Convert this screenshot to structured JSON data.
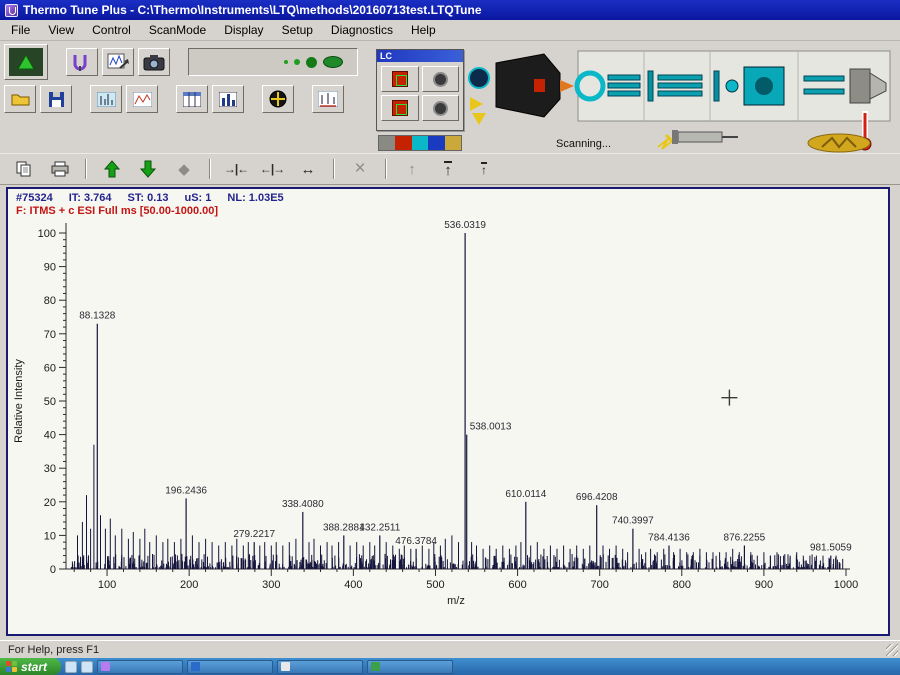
{
  "window": {
    "title": "Thermo Tune Plus - C:\\Thermo\\Instruments\\LTQ\\methods\\20160713test.LTQTune"
  },
  "menu": {
    "items": [
      "File",
      "View",
      "Control",
      "ScanMode",
      "Display",
      "Setup",
      "Diagnostics",
      "Help"
    ]
  },
  "instrument_panel": {
    "lc_title": "LC",
    "scanning_label": "Scanning..."
  },
  "scan_header": {
    "scan_number": "#75324",
    "it": "IT: 3.764",
    "st": "ST: 0.13",
    "us": "uS: 1",
    "nl": "NL: 1.03E5",
    "filter": "F: ITMS + c ESI Full ms [50.00-1000.00]"
  },
  "icons": {
    "compress_x": "→|←",
    "expand_x": "←|→",
    "full_range": "↔",
    "clear": "×",
    "diamond": "◆",
    "arrow_up": "↑"
  },
  "statusbar": {
    "help_text": "For Help, press F1"
  },
  "taskbar": {
    "start_label": "start"
  },
  "colors": {
    "titlebar_blue": "#101fa8",
    "chrome_gray": "#d6d3ce",
    "scan_header_navy": "#23238e",
    "filter_red": "#c41414",
    "spectrum_stick": "#14143c",
    "panel_border_navy": "#1a1a72"
  },
  "chart_data": {
    "type": "mass-spectrum-stick",
    "title": "",
    "xlabel": "m/z",
    "ylabel": "Relative Intensity",
    "xlim": [
      50,
      1000
    ],
    "ylim": [
      0,
      100
    ],
    "x_major_ticks": [
      100,
      200,
      300,
      400,
      500,
      600,
      700,
      800,
      900,
      1000
    ],
    "x_minor_step": 20,
    "y_major_ticks": [
      0,
      10,
      20,
      30,
      40,
      50,
      60,
      70,
      80,
      90,
      100
    ],
    "y_minor_step": 2,
    "grid": false,
    "peaks": [
      {
        "mz": 88.1328,
        "intensity": 73,
        "label": "88.1328"
      },
      {
        "mz": 196.2436,
        "intensity": 21,
        "label": "196.2436"
      },
      {
        "mz": 279.2217,
        "intensity": 8,
        "label": "279.2217"
      },
      {
        "mz": 338.408,
        "intensity": 17,
        "label": "338.4080"
      },
      {
        "mz": 388.2881,
        "intensity": 10,
        "label": "388.2881"
      },
      {
        "mz": 432.2511,
        "intensity": 10,
        "label": "432.2511"
      },
      {
        "mz": 476.3784,
        "intensity": 6,
        "label": "476.3784"
      },
      {
        "mz": 536.0319,
        "intensity": 100,
        "label": "536.0319"
      },
      {
        "mz": 538.0013,
        "intensity": 40,
        "label": "538.0013",
        "label_anchor": "start"
      },
      {
        "mz": 610.0114,
        "intensity": 20,
        "label": "610.0114"
      },
      {
        "mz": 696.4208,
        "intensity": 19,
        "label": "696.4208"
      },
      {
        "mz": 740.3997,
        "intensity": 12,
        "label": "740.3997"
      },
      {
        "mz": 784.4136,
        "intensity": 7,
        "label": "784.4136"
      },
      {
        "mz": 876.2255,
        "intensity": 7,
        "label": "876.2255"
      },
      {
        "mz": 981.5059,
        "intensity": 4,
        "label": "981.5059"
      }
    ],
    "minor_peaks": [
      [
        64,
        10
      ],
      [
        70,
        14
      ],
      [
        75,
        22
      ],
      [
        80,
        12
      ],
      [
        84,
        37
      ],
      [
        92,
        16
      ],
      [
        98,
        12
      ],
      [
        104,
        15
      ],
      [
        110,
        10
      ],
      [
        118,
        12
      ],
      [
        126,
        9
      ],
      [
        132,
        11
      ],
      [
        140,
        9
      ],
      [
        146,
        12
      ],
      [
        152,
        8
      ],
      [
        160,
        10
      ],
      [
        168,
        8
      ],
      [
        174,
        9
      ],
      [
        182,
        8
      ],
      [
        190,
        9
      ],
      [
        204,
        10
      ],
      [
        212,
        8
      ],
      [
        220,
        9
      ],
      [
        228,
        8
      ],
      [
        236,
        7
      ],
      [
        244,
        8
      ],
      [
        252,
        7
      ],
      [
        258,
        9
      ],
      [
        266,
        7
      ],
      [
        272,
        8
      ],
      [
        286,
        7
      ],
      [
        292,
        8
      ],
      [
        300,
        7
      ],
      [
        306,
        8
      ],
      [
        314,
        7
      ],
      [
        322,
        8
      ],
      [
        330,
        9
      ],
      [
        346,
        8
      ],
      [
        352,
        9
      ],
      [
        360,
        7
      ],
      [
        368,
        8
      ],
      [
        374,
        7
      ],
      [
        382,
        8
      ],
      [
        396,
        7
      ],
      [
        404,
        8
      ],
      [
        412,
        7
      ],
      [
        420,
        8
      ],
      [
        426,
        7
      ],
      [
        440,
        8
      ],
      [
        448,
        7
      ],
      [
        456,
        6
      ],
      [
        462,
        7
      ],
      [
        470,
        6
      ],
      [
        484,
        7
      ],
      [
        492,
        6
      ],
      [
        498,
        8
      ],
      [
        506,
        7
      ],
      [
        512,
        9
      ],
      [
        520,
        10
      ],
      [
        528,
        8
      ],
      [
        544,
        8
      ],
      [
        550,
        7
      ],
      [
        558,
        6
      ],
      [
        566,
        7
      ],
      [
        574,
        6
      ],
      [
        582,
        7
      ],
      [
        590,
        6
      ],
      [
        598,
        7
      ],
      [
        604,
        8
      ],
      [
        616,
        7
      ],
      [
        624,
        8
      ],
      [
        632,
        6
      ],
      [
        640,
        7
      ],
      [
        648,
        6
      ],
      [
        656,
        7
      ],
      [
        664,
        6
      ],
      [
        672,
        7
      ],
      [
        680,
        6
      ],
      [
        688,
        7
      ],
      [
        704,
        7
      ],
      [
        712,
        6
      ],
      [
        720,
        7
      ],
      [
        728,
        6
      ],
      [
        734,
        5
      ],
      [
        748,
        6
      ],
      [
        756,
        5
      ],
      [
        762,
        6
      ],
      [
        770,
        5
      ],
      [
        778,
        6
      ],
      [
        790,
        5
      ],
      [
        798,
        6
      ],
      [
        806,
        5
      ],
      [
        814,
        5
      ],
      [
        822,
        6
      ],
      [
        830,
        5
      ],
      [
        838,
        5
      ],
      [
        846,
        5
      ],
      [
        854,
        5
      ],
      [
        862,
        6
      ],
      [
        870,
        5
      ],
      [
        884,
        5
      ],
      [
        892,
        4
      ],
      [
        900,
        5
      ],
      [
        908,
        4
      ],
      [
        916,
        5
      ],
      [
        924,
        4
      ],
      [
        932,
        4
      ],
      [
        940,
        5
      ],
      [
        948,
        4
      ],
      [
        956,
        4
      ],
      [
        964,
        4
      ],
      [
        972,
        4
      ],
      [
        980,
        3
      ],
      [
        988,
        4
      ],
      [
        996,
        3
      ]
    ],
    "noise": {
      "seed": 11,
      "count": 750,
      "max": 4
    },
    "cursor": {
      "mz": 858,
      "intensity": 51
    }
  }
}
